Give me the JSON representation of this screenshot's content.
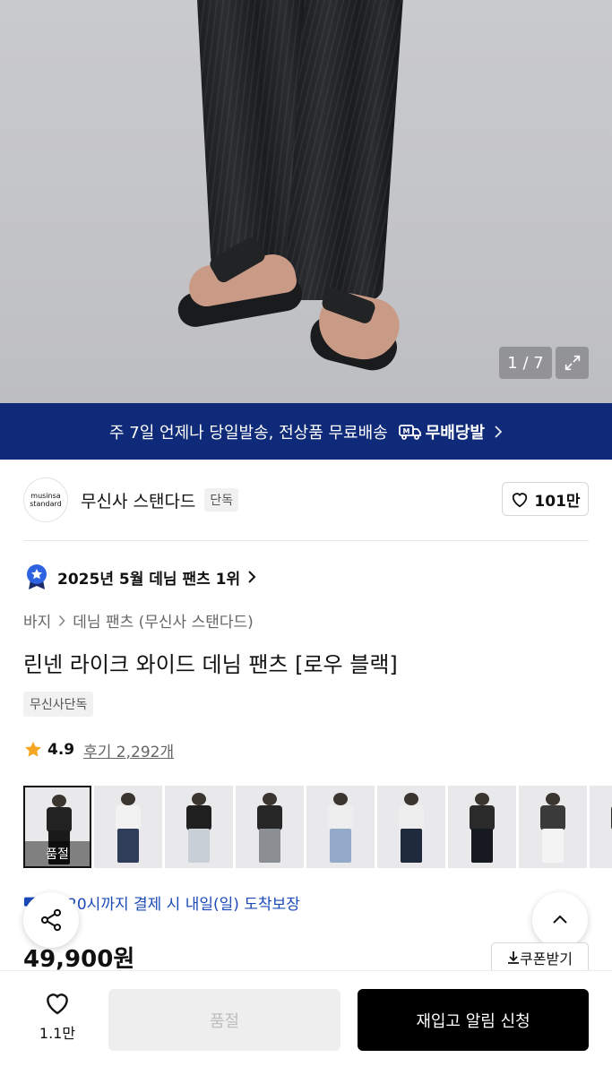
{
  "gallery": {
    "counter": "1 / 7"
  },
  "banner": {
    "text": "주 7일 언제나 당일발송, 전상품 무료배송",
    "logo_text": "무배당발"
  },
  "brand": {
    "logo_line1": "musinsa",
    "logo_line2": "standard",
    "name": "무신사 스탠다드",
    "tag": "단독",
    "likes": "101만"
  },
  "ranking": {
    "text": "2025년 5월 데님 팬츠 1위"
  },
  "breadcrumb": {
    "items": [
      "바지",
      "데님 팬츠 (무신사 스탠다드)"
    ]
  },
  "product": {
    "title": "린넨 라이크 와이드 데님 팬츠 [로우 블랙]",
    "exclusive_tag": "무신사단독",
    "rating": "4.9",
    "reviews": "후기 2,292개",
    "delivery_note": "늘 20시까지 결제 시 내일(일) 도착보장",
    "price": "49,900원"
  },
  "thumbnails": {
    "soldout_label": "품절",
    "items": [
      {
        "name": "black",
        "torso": "#222",
        "legs": "#1a1a1a",
        "soldout": true
      },
      {
        "name": "white-shirt-blue",
        "torso": "#f2f2f2",
        "legs": "#2f3d5a",
        "soldout": false
      },
      {
        "name": "black-shirt-light",
        "torso": "#1f1f1f",
        "legs": "#c9cfd6",
        "soldout": false
      },
      {
        "name": "black-shirt-grey",
        "torso": "#262626",
        "legs": "#8b8f93",
        "soldout": false
      },
      {
        "name": "light-blue",
        "torso": "#eeeeee",
        "legs": "#93aac8",
        "soldout": false
      },
      {
        "name": "dark-navy",
        "torso": "#eeeeee",
        "legs": "#1f2a3c",
        "soldout": false
      },
      {
        "name": "black-2",
        "torso": "#2a2a2a",
        "legs": "#161a20",
        "soldout": false
      },
      {
        "name": "white",
        "torso": "#3a3a3a",
        "legs": "#f4f4f4",
        "soldout": false
      },
      {
        "name": "extra",
        "torso": "#2a2a2a",
        "legs": "#2a2a2a",
        "soldout": false
      }
    ]
  },
  "actions": {
    "coupon": "쿠폰받기",
    "heart_count": "1.1만",
    "soldout_button": "품절",
    "restock_button": "재입고 알림 신청"
  },
  "colors": {
    "banner_bg": "#0f2a78",
    "delivery_blue": "#1b4ab8",
    "star": "#f5a623"
  }
}
